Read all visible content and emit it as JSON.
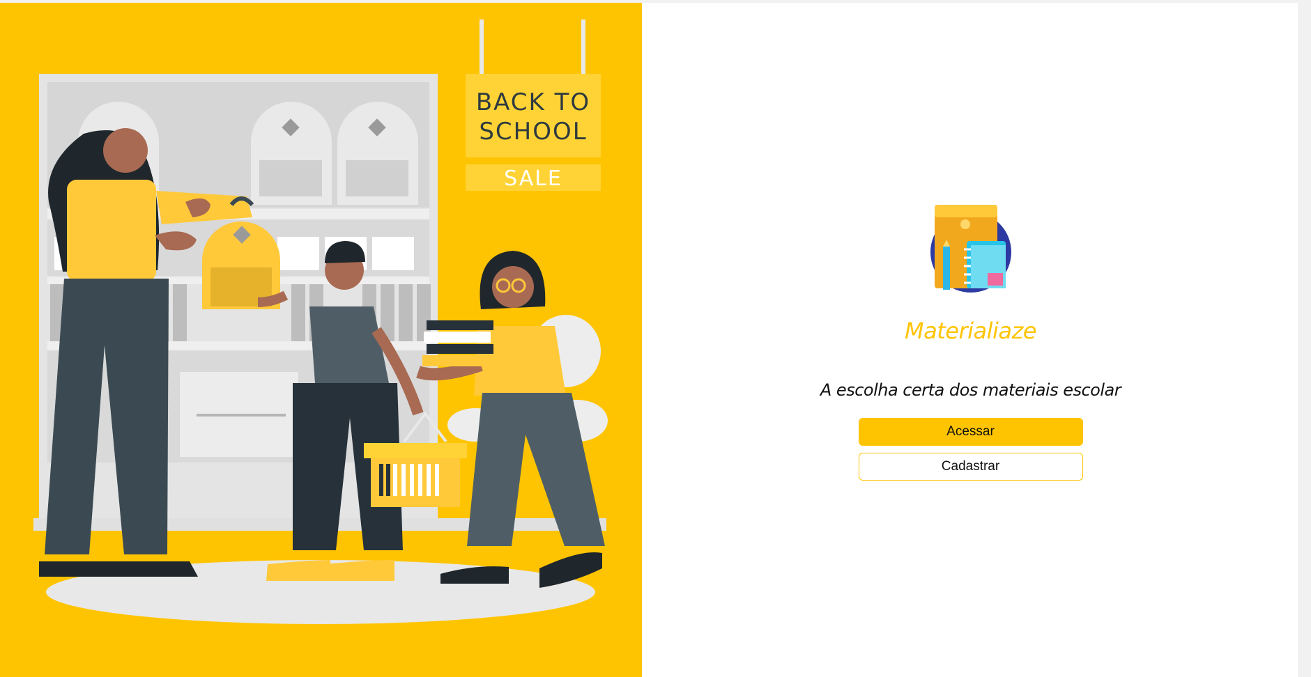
{
  "hero": {
    "sign_line1": "BACK TO",
    "sign_line2": "SCHOOL",
    "sign_sale": "SALE"
  },
  "brand": {
    "name": "Materialiaze",
    "tagline": "A escolha certa dos materiais escolar",
    "logo_icon": "school-supplies-icon",
    "accent_color": "#FFC401"
  },
  "actions": {
    "login_label": "Acessar",
    "register_label": "Cadastrar"
  }
}
